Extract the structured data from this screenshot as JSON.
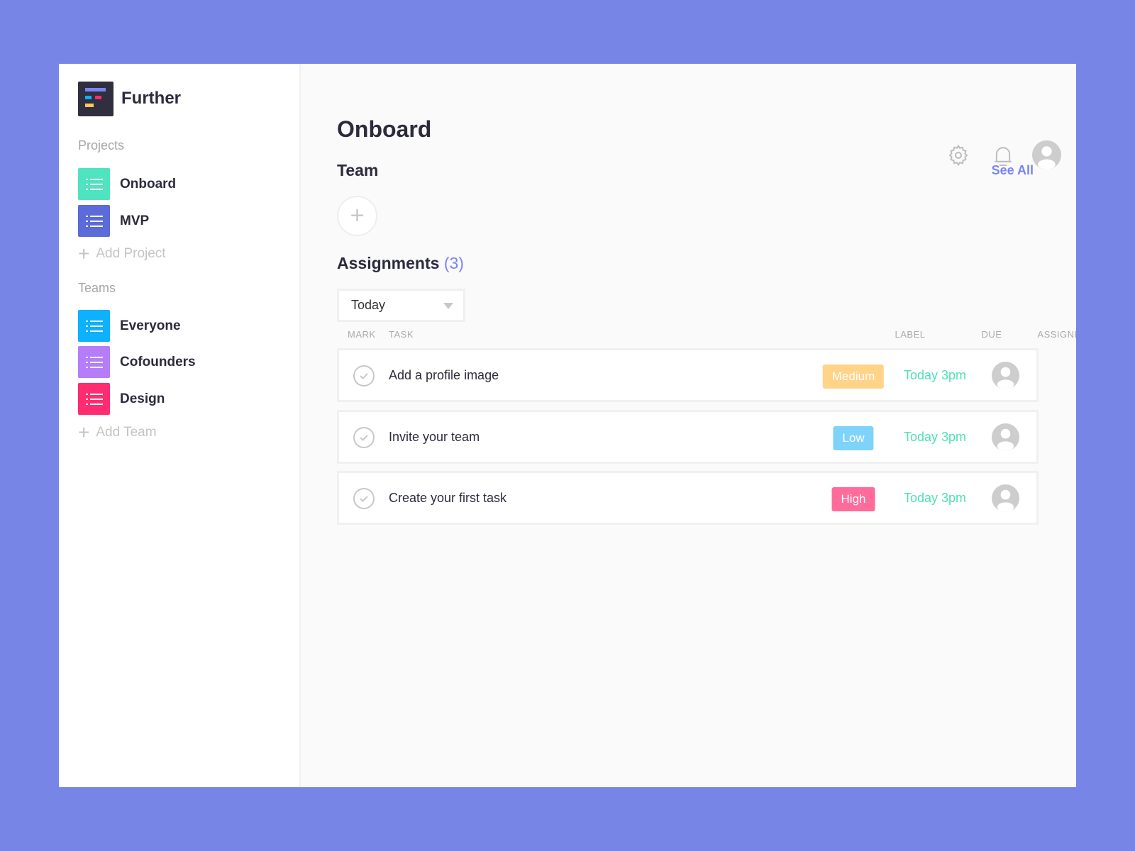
{
  "app": {
    "name": "Further"
  },
  "sidebar": {
    "projects_label": "Projects",
    "projects": [
      {
        "label": "Onboard",
        "color": "#4fe3c0"
      },
      {
        "label": "MVP",
        "color": "#5b6bd9"
      }
    ],
    "add_project": "Add Project",
    "teams_label": "Teams",
    "teams": [
      {
        "label": "Everyone",
        "color": "#0db1fc"
      },
      {
        "label": "Cofounders",
        "color": "#b57ef8"
      },
      {
        "label": "Design",
        "color": "#ff2d6f"
      }
    ],
    "add_team": "Add Team"
  },
  "header": {
    "icons": [
      "gear-icon",
      "bell-icon",
      "user-avatar-icon"
    ]
  },
  "main": {
    "title": "Onboard",
    "team_heading": "Team",
    "see_all": "See All",
    "assignments_heading": "Assignments",
    "assignments_count": "(3)",
    "filter": "Today",
    "columns": {
      "mark": "MARK",
      "task": "TASK",
      "label": "LABEL",
      "due": "DUE",
      "assigned": "ASSIGNED"
    },
    "rows": [
      {
        "task": "Add a profile image",
        "label": "Medium",
        "label_color": "#ffd388",
        "due": "Today 3pm"
      },
      {
        "task": "Invite your team",
        "label": "Low",
        "label_color": "#7ed3fb",
        "due": "Today 3pm"
      },
      {
        "task": "Create your first task",
        "label": "High",
        "label_color": "#ff6b9a",
        "due": "Today 3pm"
      }
    ]
  },
  "colors": {
    "background": "#7785e6",
    "accent": "#7b84f5",
    "due": "#4fe0b5"
  }
}
